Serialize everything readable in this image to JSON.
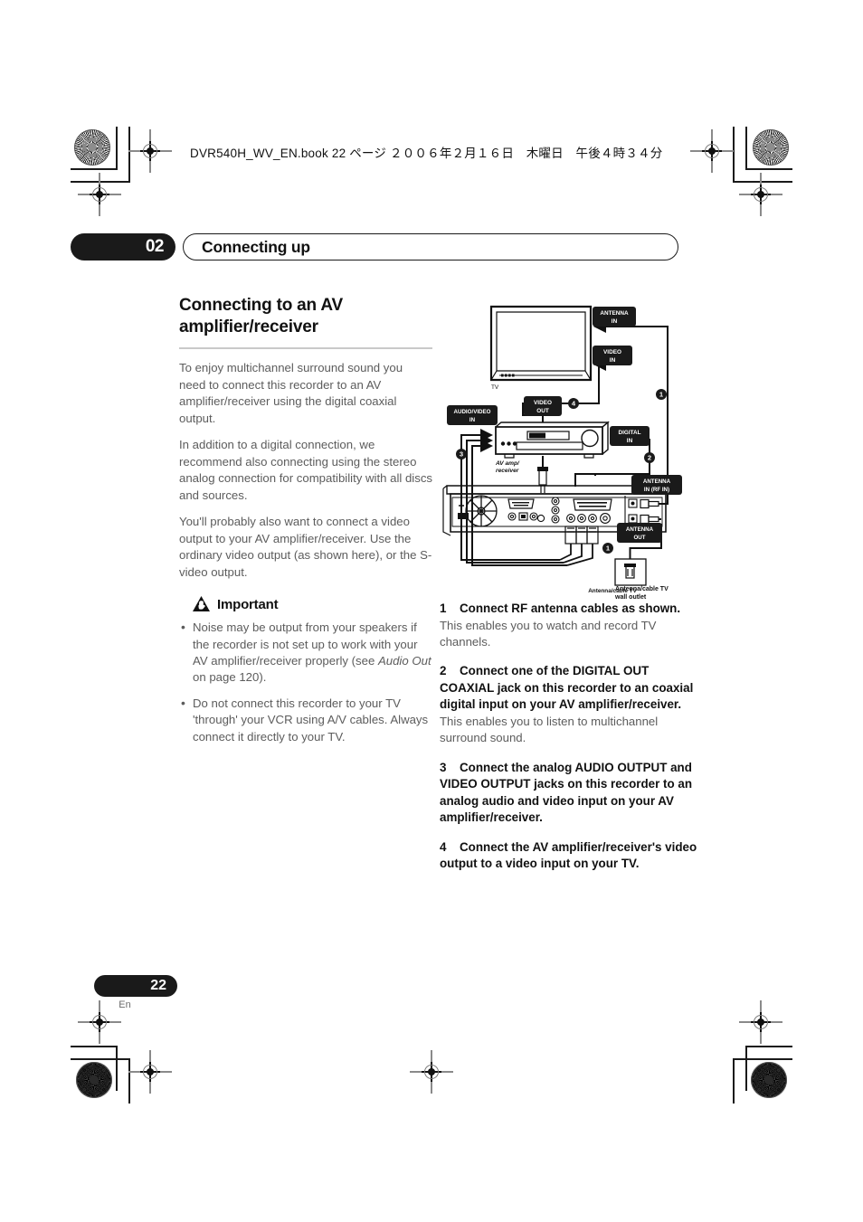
{
  "header": {
    "file_line": "DVR540H_WV_EN.book  22 ページ  ２００６年２月１６日　木曜日　午後４時３４分"
  },
  "chapter": {
    "number": "02",
    "title": "Connecting up"
  },
  "left_column": {
    "heading": "Connecting to an AV amplifier/receiver",
    "paragraphs": [
      "To enjoy multichannel surround sound you need to connect this recorder to an AV amplifier/receiver using the digital coaxial output.",
      "In addition to a digital connection, we recommend also connecting using the stereo analog connection for compatibility with all discs and sources.",
      "You'll probably also want to connect a video output to your AV amplifier/receiver. Use the ordinary video output (as shown here), or the S-video output."
    ],
    "important": {
      "icon": "warning-triangle-icon",
      "title": "Important",
      "bullets": [
        "Noise may be output from your speakers if the recorder is not set up to work with your AV amplifier/receiver properly (see Audio Out on page 120).",
        "Do not connect this recorder to your TV 'through' your VCR using A/V cables. Always connect it directly to your TV."
      ],
      "bullet1_italic": "Audio Out",
      "bullet1_pre": "Noise may be output from your speakers if the recorder is not set up to work with your AV amplifier/receiver properly (see ",
      "bullet1_post": " on page 120).",
      "bullet2": "Do not connect this recorder to your TV 'through' your VCR using A/V cables. Always connect it directly to your TV."
    }
  },
  "right_column": {
    "steps": [
      {
        "number": "1",
        "title": "Connect RF antenna cables as shown.",
        "description": "This enables you to watch and record TV channels."
      },
      {
        "number": "2",
        "title": "Connect one of the DIGITAL OUT COAXIAL jack on this recorder to an coaxial digital input on your AV amplifier/receiver.",
        "description": "This enables you to listen to multichannel surround sound."
      },
      {
        "number": "3",
        "title": "Connect the analog AUDIO OUTPUT and VIDEO OUTPUT jacks on this recorder to an analog audio and video input on your AV amplifier/receiver.",
        "description": ""
      },
      {
        "number": "4",
        "title": "Connect the AV amplifier/receiver's video output to a video input on your TV.",
        "description": ""
      }
    ]
  },
  "diagram": {
    "labels": {
      "antenna_in": "ANTENNA\nIN",
      "antenna_in_l1": "ANTENNA",
      "antenna_in_l2": "IN",
      "video_in_l1": "VIDEO",
      "video_in_l2": "IN",
      "audio_video_in_l1": "AUDIO/VIDEO",
      "audio_video_in_l2": "IN",
      "video_out_l1": "VIDEO",
      "video_out_l2": "OUT",
      "digital_in_l1": "DIGITAL",
      "digital_in_l2": "IN",
      "antenna_in_rf_l1": "ANTENNA",
      "antenna_in_rf_l2": "IN (RF IN)",
      "antenna_out_l1": "ANTENNA",
      "antenna_out_l2": "OUT",
      "tv": "TV",
      "av_amp_l1": "AV amp/",
      "av_amp_l2": "receiver",
      "wall_outlet_l1": "Antenna/cable TV",
      "wall_outlet_l2": "wall outlet"
    },
    "callouts": [
      "1",
      "2",
      "3",
      "4"
    ]
  },
  "footer": {
    "page_number": "22",
    "language": "En"
  },
  "colors": {
    "ink": "#111111",
    "body_text": "#5c5c5c",
    "rule": "#c9c9c9",
    "label_bg": "#1a1a1a"
  }
}
